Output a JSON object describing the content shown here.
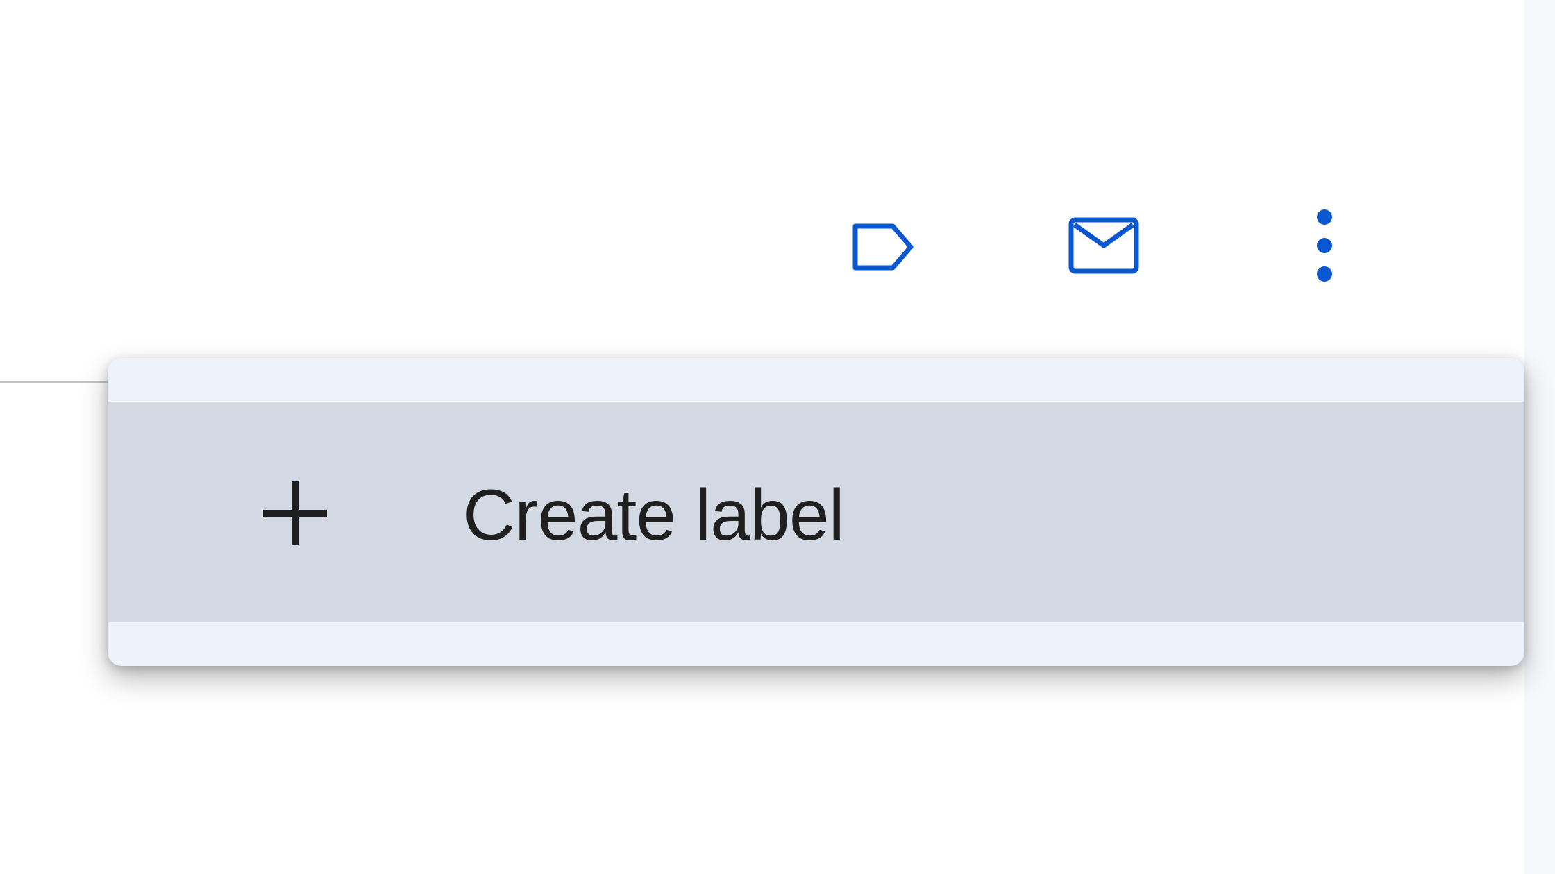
{
  "toolbar": {
    "buttons": [
      {
        "id": "label",
        "icon": "label-icon",
        "color": "#0b57d0"
      },
      {
        "id": "mark-unread",
        "icon": "mail-icon",
        "color": "#0b57d0"
      },
      {
        "id": "more",
        "icon": "more-vert-icon",
        "color": "#0b57d0"
      }
    ]
  },
  "menu": {
    "items": [
      {
        "icon": "plus-icon",
        "label": "Create label"
      }
    ]
  },
  "colors": {
    "accent": "#0b57d0",
    "menu_background": "#eef2fa",
    "menu_item_hover": "#d3d9e3",
    "text": "#1f1f1f"
  }
}
